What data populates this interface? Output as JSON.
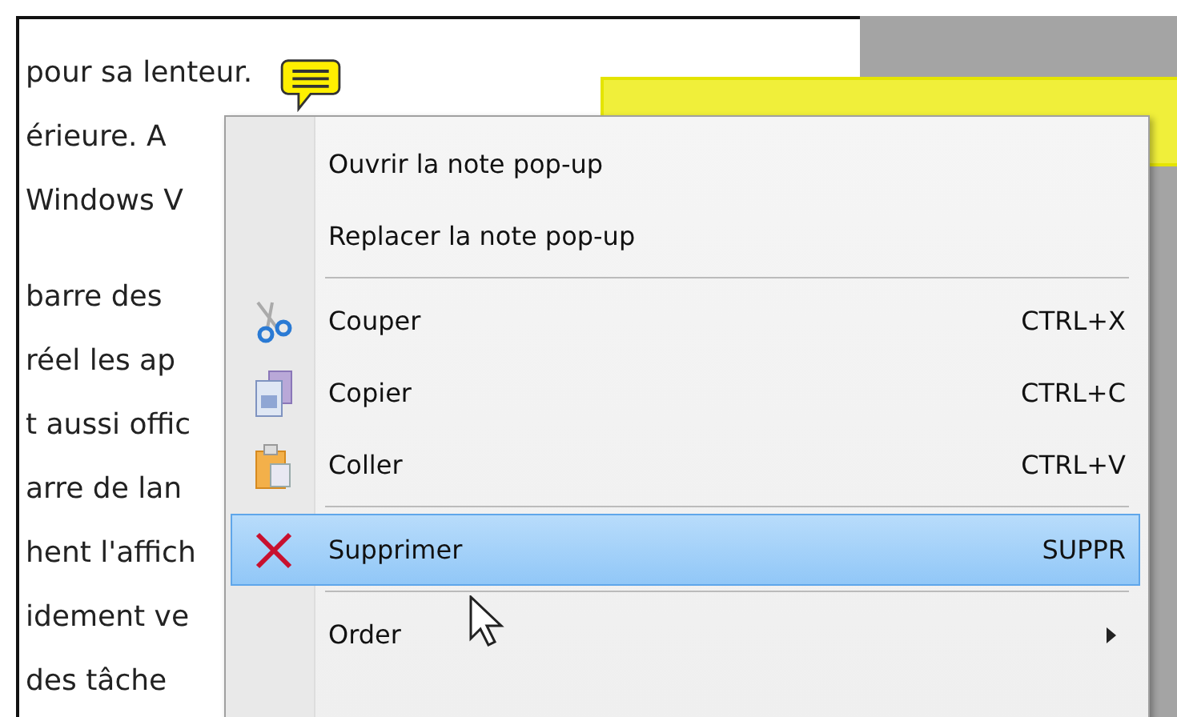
{
  "document": {
    "lines": [
      "pour sa lenteur.",
      "érieure. A",
      "Windows V",
      "barre des",
      "réel les ap",
      "t aussi offic",
      "arre de lan",
      "hent l'affich",
      "idement ve",
      "des tâche"
    ]
  },
  "context_menu": {
    "items": [
      {
        "kind": "action",
        "label": "Ouvrir la note pop-up",
        "selected": false
      },
      {
        "kind": "action",
        "label": "Replacer la note pop-up",
        "selected": false
      },
      {
        "kind": "separator"
      },
      {
        "kind": "action",
        "label": "Couper",
        "shortcut": "CTRL+X",
        "selected": false
      },
      {
        "kind": "action",
        "label": "Copier",
        "shortcut": "CTRL+C",
        "selected": false
      },
      {
        "kind": "action",
        "label": "Coller",
        "shortcut": "CTRL+V",
        "selected": false
      },
      {
        "kind": "separator"
      },
      {
        "kind": "action",
        "label": "Supprimer",
        "shortcut": "SUPPR",
        "selected": true
      },
      {
        "kind": "separator"
      },
      {
        "kind": "submenu",
        "label": "Order",
        "selected": false
      }
    ]
  }
}
